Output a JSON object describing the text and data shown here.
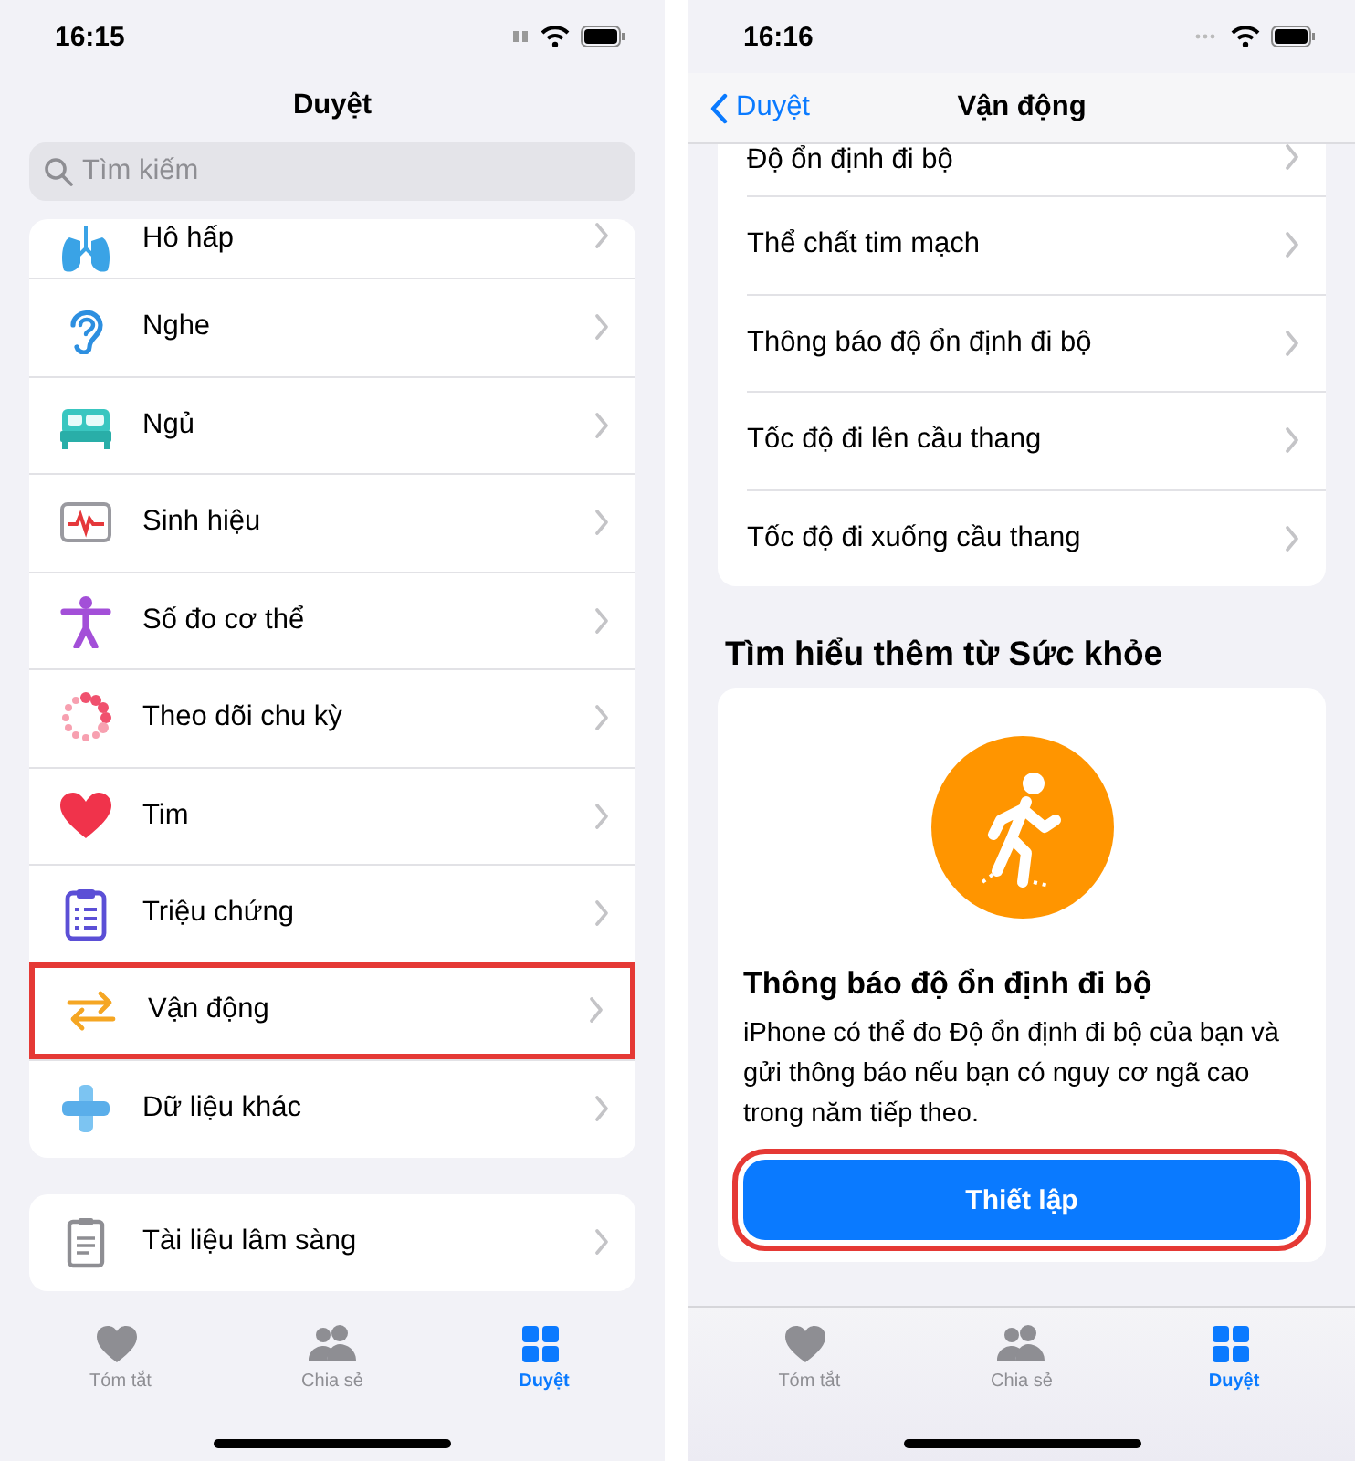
{
  "browse_screen": {
    "status_time": "16:15",
    "title": "Duyệt",
    "search": {
      "placeholder": "Tìm kiếm"
    },
    "categories": [
      {
        "label": "Hô hấp",
        "highlighted": false
      },
      {
        "label": "Nghe",
        "highlighted": false
      },
      {
        "label": "Ngủ",
        "highlighted": false
      },
      {
        "label": "Sinh hiệu",
        "highlighted": false
      },
      {
        "label": "Số đo cơ thể",
        "highlighted": false
      },
      {
        "label": "Theo dõi chu kỳ",
        "highlighted": false
      },
      {
        "label": "Tim",
        "highlighted": false
      },
      {
        "label": "Triệu chứng",
        "highlighted": false
      },
      {
        "label": "Vận động",
        "highlighted": true
      },
      {
        "label": "Dữ liệu khác",
        "highlighted": false
      }
    ],
    "records": [
      {
        "label": "Tài liệu lâm sàng",
        "highlighted": false
      }
    ],
    "tabs": [
      {
        "label": "Tóm tắt",
        "selected": false
      },
      {
        "label": "Chia sẻ",
        "selected": false
      },
      {
        "label": "Duyệt",
        "selected": true
      }
    ]
  },
  "detail_screen": {
    "status_time": "16:16",
    "back": "Duyệt",
    "title": "Vận động",
    "items": [
      {
        "label": "Độ ổn định đi bộ"
      },
      {
        "label": "Thể chất tim mạch"
      },
      {
        "label": "Thông báo độ ổn định đi bộ"
      },
      {
        "label": "Tốc độ đi lên cầu thang"
      },
      {
        "label": "Tốc độ đi xuống cầu thang"
      }
    ],
    "section_title": "Tìm hiểu thêm từ Sức khỏe",
    "feature": {
      "title": "Thông báo độ ổn định đi bộ",
      "description": "iPhone có thể đo Độ ổn định đi bộ của bạn và gửi thông báo nếu bạn có nguy cơ ngã cao trong năm tiếp theo.",
      "button": {
        "label": "Thiết lập",
        "highlighted": true
      }
    },
    "tabs": [
      {
        "label": "Tóm tắt",
        "selected": false
      },
      {
        "label": "Chia sẻ",
        "selected": false
      },
      {
        "label": "Duyệt",
        "selected": true
      }
    ]
  }
}
